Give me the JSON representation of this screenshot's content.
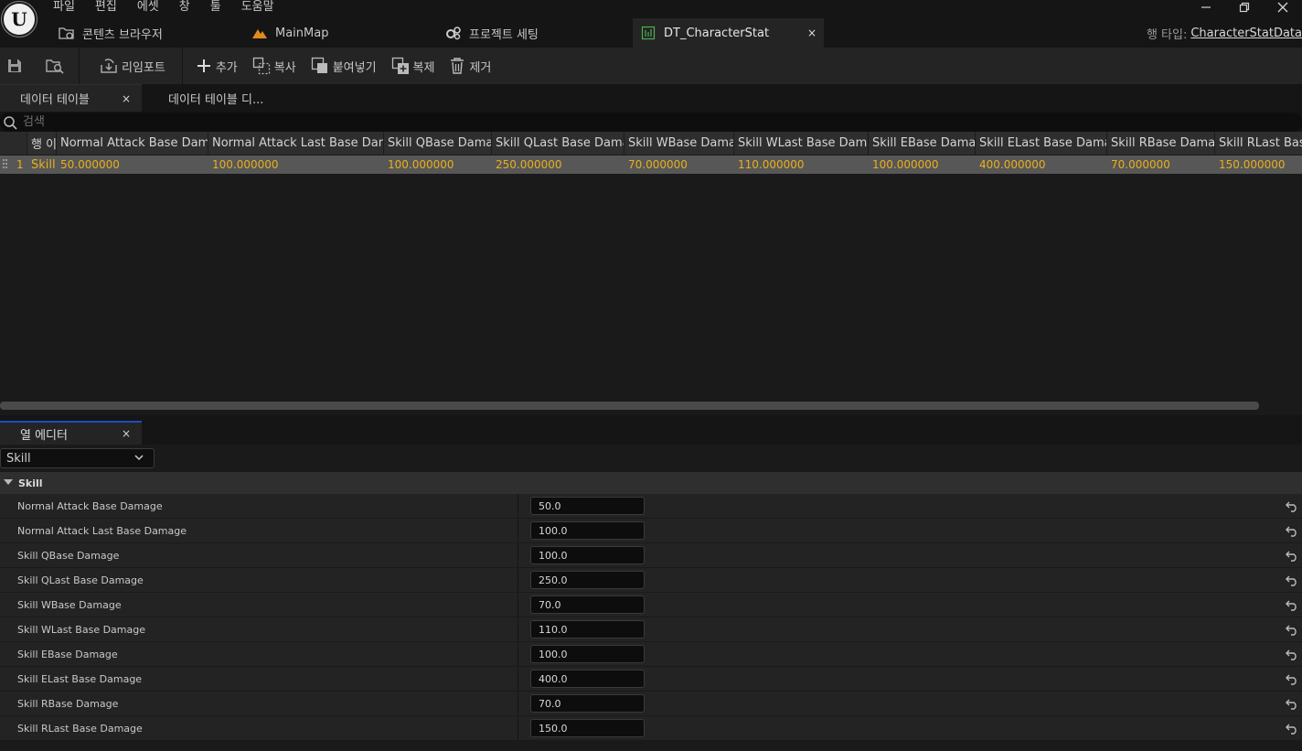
{
  "menu": [
    "파일",
    "편집",
    "에셋",
    "창",
    "툴",
    "도움말"
  ],
  "logo_text": "U",
  "doc_tabs": [
    {
      "label": "콘텐츠 브라우저",
      "icon": "content-browser-icon"
    },
    {
      "label": "MainMap",
      "icon": "map-icon"
    },
    {
      "label": "프로젝트 세팅",
      "icon": "settings-gears-icon"
    },
    {
      "label": "DT_CharacterStat",
      "icon": "datatable-icon",
      "close": "×"
    }
  ],
  "row_type": {
    "label": "행 타입:",
    "value": "CharacterStatData"
  },
  "toolbar": {
    "reimport": "리임포트",
    "add": "추가",
    "copy": "복사",
    "paste": "붙여넣기",
    "duplicate": "복제",
    "remove": "제거"
  },
  "sub_tabs": {
    "active": "데이터 테이블",
    "active_close": "×",
    "other": "데이터 테이블 디..."
  },
  "search": {
    "placeholder": "검색"
  },
  "table": {
    "headers": [
      "행 이름",
      "Normal Attack Base Damage",
      "Normal Attack Last Base Damage",
      "Skill QBase Damage",
      "Skill QLast Base Damage",
      "Skill WBase Damage",
      "Skill WLast Base Damage",
      "Skill EBase Damage",
      "Skill ELast Base Damage",
      "Skill RBase Damage",
      "Skill RLast Base Damage"
    ],
    "rows": [
      {
        "index": "1",
        "name": "Skill",
        "values": [
          "50.000000",
          "100.000000",
          "100.000000",
          "250.000000",
          "70.000000",
          "110.000000",
          "100.000000",
          "400.000000",
          "70.000000",
          "150.000000"
        ]
      }
    ]
  },
  "column_editor": {
    "tab_label": "열 에디터",
    "tab_close": "×",
    "selected_row": "Skill",
    "section": "Skill",
    "properties": [
      {
        "label": "Normal Attack Base Damage",
        "value": "50.0"
      },
      {
        "label": "Normal Attack Last Base Damage",
        "value": "100.0"
      },
      {
        "label": "Skill QBase Damage",
        "value": "100.0"
      },
      {
        "label": "Skill QLast Base Damage",
        "value": "250.0"
      },
      {
        "label": "Skill WBase Damage",
        "value": "70.0"
      },
      {
        "label": "Skill WLast Base Damage",
        "value": "110.0"
      },
      {
        "label": "Skill EBase Damage",
        "value": "100.0"
      },
      {
        "label": "Skill ELast Base Damage",
        "value": "400.0"
      },
      {
        "label": "Skill RBase Damage",
        "value": "70.0"
      },
      {
        "label": "Skill RLast Base Damage",
        "value": "150.0"
      }
    ]
  },
  "colors": {
    "accent_tab": "#1b4dbf",
    "value_text": "#e9b01c",
    "selected_row": "#575757"
  }
}
